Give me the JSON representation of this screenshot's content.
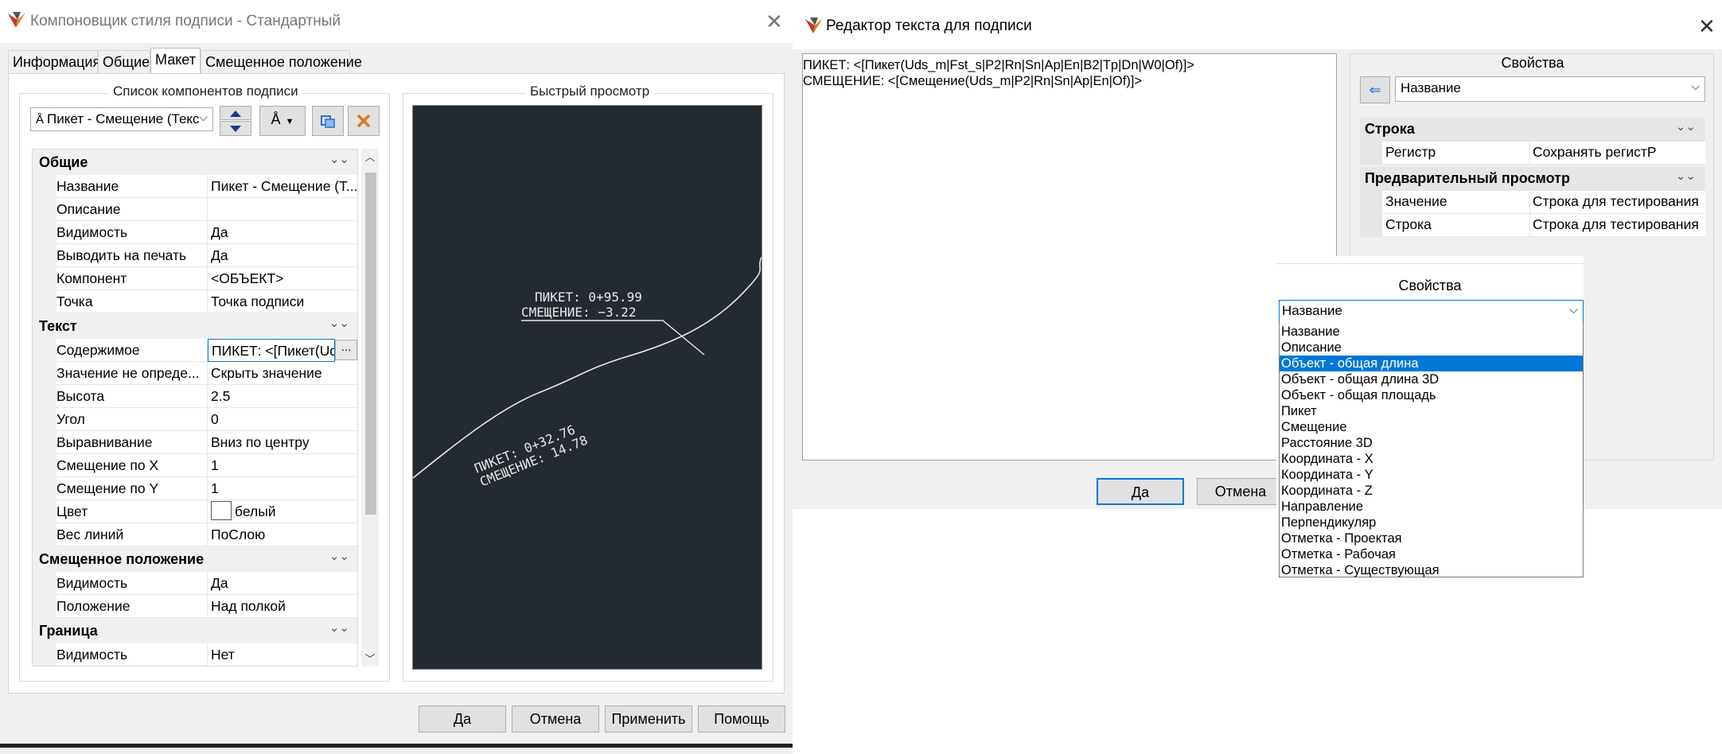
{
  "left_dialog": {
    "title": "Компоновщик стиля подписи - Стандартный",
    "tabs": [
      "Информация",
      "Общие",
      "Макет",
      "Смещенное положение"
    ],
    "components_group_title": "Список компонентов подписи",
    "component_select": "Пикет - Смещение (Текс",
    "preview_group_title": "Быстрый просмотр",
    "property_grid": {
      "general": {
        "title": "Общие",
        "rows": [
          {
            "name": "Название",
            "value": "Пикет - Смещение (Т..."
          },
          {
            "name": "Описание",
            "value": ""
          },
          {
            "name": "Видимость",
            "value": "Да"
          },
          {
            "name": "Выводить на печать",
            "value": "Да"
          },
          {
            "name": "Компонент",
            "value": "<ОБЪЕКТ>"
          },
          {
            "name": "Точка",
            "value": "Точка подписи"
          }
        ]
      },
      "text": {
        "title": "Текст",
        "rows": [
          {
            "name": "Содержимое",
            "value": "ПИКЕТ: <[Пикет(Uds"
          },
          {
            "name": "Значение не опреде...",
            "value": "Скрыть значение"
          },
          {
            "name": "Высота",
            "value": "2.5"
          },
          {
            "name": "Угол",
            "value": "0"
          },
          {
            "name": "Выравнивание",
            "value": "Вниз по центру"
          },
          {
            "name": "Смещение по X",
            "value": "1"
          },
          {
            "name": "Смещение по Y",
            "value": "1"
          },
          {
            "name": "Цвет",
            "value": "белый"
          },
          {
            "name": "Вес линий",
            "value": "ПоСлою"
          }
        ]
      },
      "offset": {
        "title": "Смещенное положение",
        "rows": [
          {
            "name": "Видимость",
            "value": "Да"
          },
          {
            "name": "Положение",
            "value": "Над полкой"
          }
        ]
      },
      "border": {
        "title": "Граница",
        "rows": [
          {
            "name": "Видимость",
            "value": "Нет"
          }
        ]
      },
      "ellipsis": "..."
    },
    "preview": {
      "label1_line1": "ПИКЕТ: 0+95.99",
      "label1_line2": "СМЕЩЕНИЕ: −3.22",
      "label2_line1": "ПИКЕТ: 0+32.76",
      "label2_line2": "СМЕЩЕНИЕ: 14.78"
    },
    "buttons": {
      "ok": "Да",
      "cancel": "Отмена",
      "apply": "Применить",
      "help": "Помощь"
    }
  },
  "right_dialog": {
    "title": "Редактор текста для подписи",
    "editor_lines": [
      "ПИКЕТ: <[Пикет(Uds_m|Fst_s|P2|Rn|Sn|Ap|En|B2|Tp|Dn|W0|Of)]>",
      "СМЕЩЕНИЕ: <[Смещение(Uds_m|P2|Rn|Sn|Ap|En|Of)]>"
    ],
    "properties_title": "Свойства",
    "property_select": "Название",
    "row_cat": "Строка",
    "row_case_name": "Регистр",
    "row_case_value": "Сохранять регистР",
    "preview_cat": "Предварительный просмотр",
    "preview_rows": [
      {
        "name": "Значение",
        "value": "Строка для тестирования"
      },
      {
        "name": "Строка",
        "value": "Строка для тестирования"
      }
    ],
    "buttons": {
      "ok": "Да",
      "cancel": "Отмена"
    }
  },
  "popup": {
    "title": "Свойства",
    "selected": "Название",
    "options": [
      "Название",
      "Описание",
      "Объект - общая длина",
      "Объект - общая длина 3D",
      "Объект - общая площадь",
      "Пикет",
      "Смещение",
      "Расстояние 3D",
      "Координата - X",
      "Координата - Y",
      "Координата - Z",
      "Направление",
      "Перпендикуляр",
      "Отметка - Проектая",
      "Отметка - Рабочая",
      "Отметка - Существующая"
    ],
    "highlighted_index": 2
  },
  "colors": {
    "accent": "#0078d7",
    "preview_bg": "#242a32",
    "dialog_bg": "#f0f0f0"
  }
}
